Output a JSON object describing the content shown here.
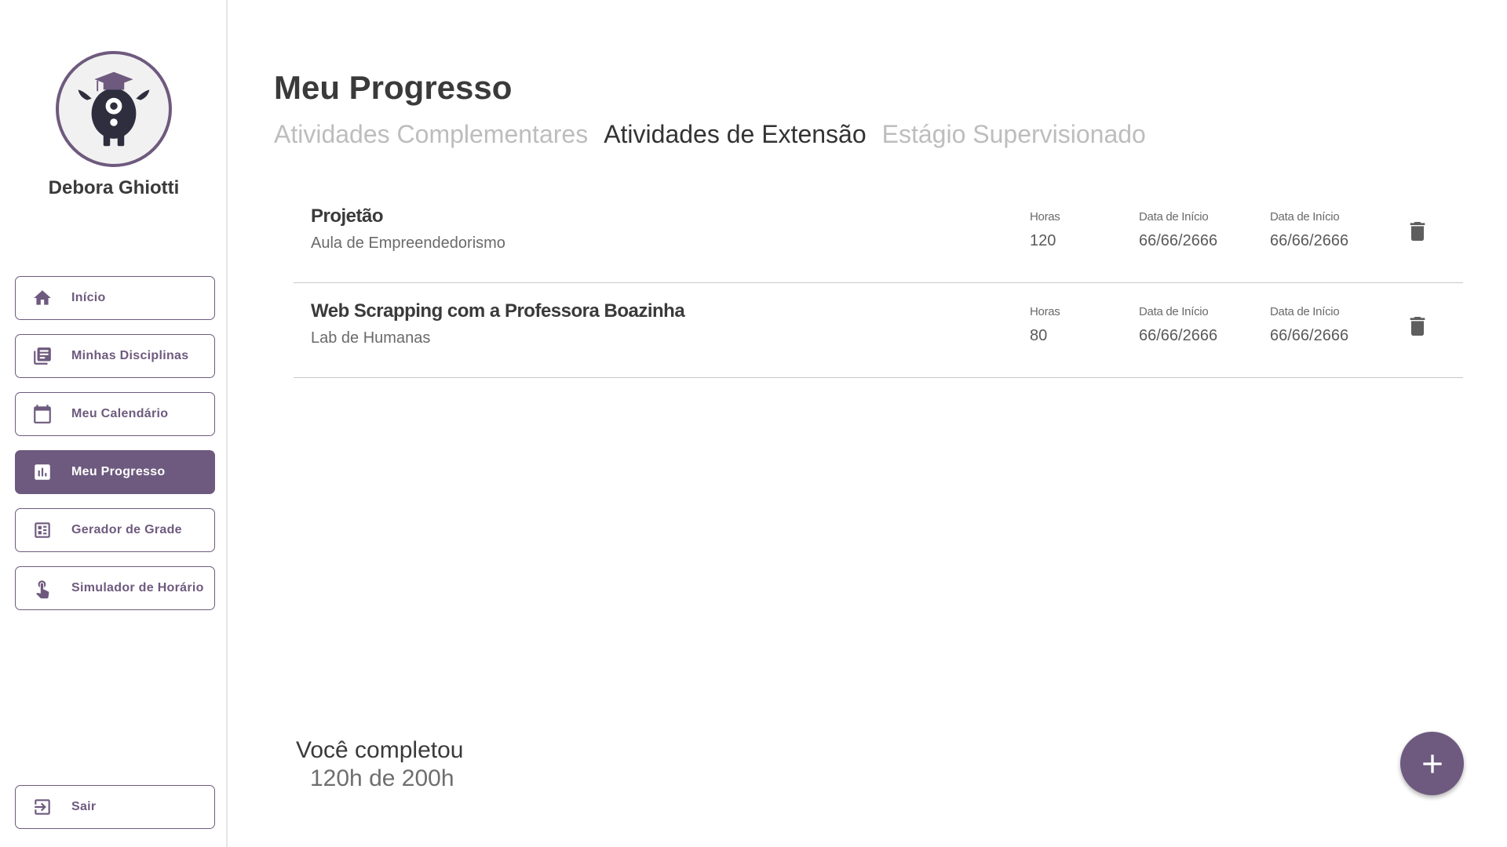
{
  "colors": {
    "accent": "#6e5a7e",
    "tab_inactive": "#bdbdbd",
    "tab_active": "#333333"
  },
  "user": {
    "name": "Debora Ghiotti"
  },
  "sidebar": {
    "items": [
      {
        "label": "Início",
        "icon": "home-icon"
      },
      {
        "label": "Minhas Disciplinas",
        "icon": "library-books-icon"
      },
      {
        "label": "Meu Calendário",
        "icon": "calendar-icon"
      },
      {
        "label": "Meu Progresso",
        "icon": "chart-icon",
        "active": true
      },
      {
        "label": "Gerador de Grade",
        "icon": "grid-icon"
      },
      {
        "label": "Simulador de Horário",
        "icon": "touch-icon"
      }
    ],
    "logout": {
      "label": "Sair",
      "icon": "logout-icon"
    }
  },
  "main": {
    "title": "Meu Progresso",
    "tabs": [
      {
        "label": "Atividades Complementares",
        "active": false
      },
      {
        "label": "Atividades de Extensão",
        "active": true
      },
      {
        "label": "Estágio Supervisionado",
        "active": false
      }
    ],
    "activities": [
      {
        "title": "Projetão",
        "subtitle": "Aula de Empreendedorismo",
        "hours_label": "Horas",
        "hours": "120",
        "start_label": "Data de Início",
        "start": "66/66/2666",
        "end_label": "Data de Início",
        "end": "66/66/2666"
      },
      {
        "title": "Web Scrapping com a Professora Boazinha",
        "subtitle": "Lab de Humanas",
        "hours_label": "Horas",
        "hours": "80",
        "start_label": "Data de Início",
        "start": "66/66/2666",
        "end_label": "Data de Início",
        "end": "66/66/2666"
      }
    ],
    "summary": {
      "line1": "Você completou",
      "line2": "120h de 200h"
    }
  }
}
